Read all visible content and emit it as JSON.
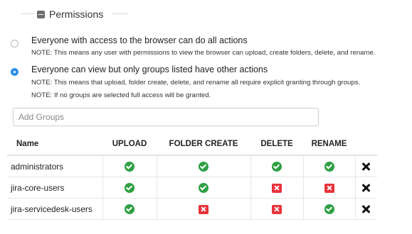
{
  "section": {
    "title": "Permissions"
  },
  "options": [
    {
      "label": "Everyone with access to the browser can do all actions",
      "checked": false,
      "notes": [
        "NOTE: This means any user with permissions to view the browser can upload, create folders, delete, and rename."
      ]
    },
    {
      "label": "Everyone can view but only groups listed have other actions",
      "checked": true,
      "notes": [
        "NOTE: This means that upload, folder create, delete, and rename all require explicit granting through groups.",
        "NOTE: If no groups are selected full access will be granted."
      ]
    }
  ],
  "add_groups": {
    "placeholder": "Add Groups",
    "value": ""
  },
  "table": {
    "headers": {
      "name": "Name",
      "upload": "UPLOAD",
      "folder_create": "FOLDER CREATE",
      "delete": "DELETE",
      "rename": "RENAME"
    },
    "rows": [
      {
        "name": "administrators",
        "upload": true,
        "folder_create": true,
        "delete": true,
        "rename": true
      },
      {
        "name": "jira-core-users",
        "upload": true,
        "folder_create": true,
        "delete": false,
        "rename": false
      },
      {
        "name": "jira-servicedesk-users",
        "upload": true,
        "folder_create": false,
        "delete": false,
        "rename": true
      }
    ]
  },
  "colors": {
    "check_green": "#2ea043",
    "deny_red": "#e8333b",
    "radio_blue": "#2f8fe8"
  },
  "icons": {
    "granted": "check-circle-icon",
    "denied": "red-x-icon",
    "remove": "remove-x-icon",
    "collapse": "collapse-minus-icon"
  }
}
